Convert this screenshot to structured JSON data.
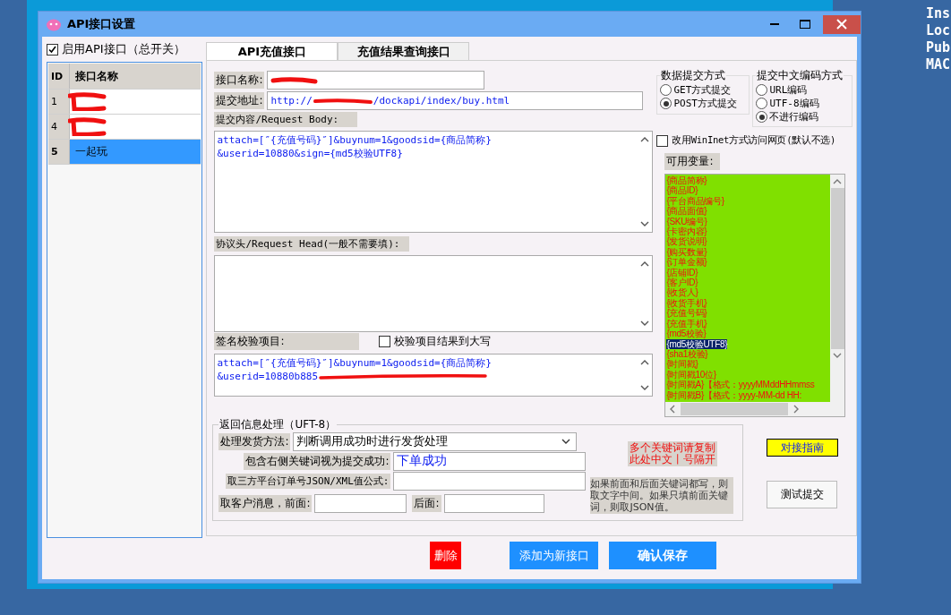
{
  "window": {
    "title": "API接口设置"
  },
  "desktop_text": [
    "Ins",
    "Loc",
    "Pub",
    "MAC"
  ],
  "master_switch": {
    "label": "启用API接口（总开关）",
    "checked": true
  },
  "interface_list": {
    "columns": [
      "ID",
      "接口名称"
    ],
    "rows": [
      {
        "id": "1",
        "redacted": true,
        "selected": false
      },
      {
        "id": "4",
        "redacted": true,
        "selected": false
      },
      {
        "id": "5",
        "name": "一起玩",
        "redacted": false,
        "selected": true
      }
    ]
  },
  "tabs": [
    {
      "label": "API充值接口",
      "selected": true
    },
    {
      "label": "充值结果查询接口",
      "selected": false
    }
  ],
  "form": {
    "name": {
      "label": "接口名称:",
      "redacted": true
    },
    "url": {
      "label": "提交地址:",
      "prefix": "http://",
      "suffix": "/dockapi/index/buy.html",
      "redacted": true
    },
    "body": {
      "label": "提交内容/Request Body:",
      "lines": [
        "attach=[″{充值号码}″]&buynum=1&goodsid={商品简称}",
        "&userid=10880&sign={md5校验UTF8}"
      ]
    },
    "head": {
      "label": "协议头/Request Head(一般不需要填):"
    },
    "sign": {
      "label": "签名校验项目:",
      "uppercase_label": "校验项目结果到大写",
      "uppercase": false,
      "lines": [
        "attach=[″{充值号码}″]&buynum=1&goodsid={商品简称}",
        "&userid=10880b885"
      ],
      "redacted": true
    }
  },
  "submit_method": {
    "title": "数据提交方式",
    "options": [
      {
        "label": "GET方式提交",
        "selected": false
      },
      {
        "label": "POST方式提交",
        "selected": true
      }
    ]
  },
  "encoding": {
    "title": "提交中文编码方式",
    "options": [
      {
        "label": "URL编码",
        "selected": false
      },
      {
        "label": "UTF-8编码",
        "selected": false
      },
      {
        "label": "不进行编码",
        "selected": true
      }
    ]
  },
  "wininet": {
    "label": "改用WinInet方式访问网页(默认不选)",
    "checked": false
  },
  "variables": {
    "label": "可用变量:",
    "items": [
      {
        "text": "{商品简称}",
        "selected": false
      },
      {
        "text": "{商品ID}",
        "selected": false
      },
      {
        "text": "{平台商品编号}",
        "selected": false
      },
      {
        "text": "{商品面值}",
        "selected": false
      },
      {
        "text": "{SKU编号}",
        "selected": false
      },
      {
        "text": "{卡密内容}",
        "selected": false
      },
      {
        "text": "{发货说明}",
        "selected": false
      },
      {
        "text": "{购买数量}",
        "selected": false
      },
      {
        "text": "{订单金额}",
        "selected": false
      },
      {
        "text": "{店铺ID}",
        "selected": false
      },
      {
        "text": "{客户ID}",
        "selected": false
      },
      {
        "text": "{收货人}",
        "selected": false
      },
      {
        "text": "{收货手机}",
        "selected": false
      },
      {
        "text": "{充值号码}",
        "selected": false
      },
      {
        "text": "{充值手机}",
        "selected": false
      },
      {
        "text": "{md5校验}",
        "selected": false
      },
      {
        "text": "{md5校验UTF8}",
        "selected": true
      },
      {
        "text": "{sha1校验}",
        "selected": false
      },
      {
        "text": "{时间戳}",
        "selected": false
      },
      {
        "text": "{时间戳10位}",
        "selected": false
      },
      {
        "text": "{时间戳A}【格式：yyyyMMddHHmmss",
        "selected": false
      },
      {
        "text": "{时间戳B}【格式：yyyy-MM-dd HH:",
        "selected": false
      }
    ]
  },
  "response": {
    "title": "返回信息处理（UFT-8）",
    "method": {
      "label": "处理发货方法:",
      "value": "判断调用成功时进行发货处理"
    },
    "success_keyword": {
      "label": "包含右侧关键词视为提交成功:",
      "value": "下单成功"
    },
    "order_formula": {
      "label": "取三方平台订单号JSON/XML值公式:"
    },
    "message_before": {
      "label": "取客户消息，前面:"
    },
    "message_after": {
      "label": "后面:"
    },
    "keyword_note": [
      "多个关键词请复制",
      "此处中文丨号隔开"
    ],
    "hint": "如果前面和后面关键词都写，则取文字中间。如果只填前面关键词，则取JSON值。"
  },
  "side_buttons": [
    {
      "label": "对接指南",
      "kind": "guide"
    },
    {
      "label": "测试提交",
      "kind": "plain"
    }
  ],
  "buttons": [
    {
      "label": "删除",
      "kind": "danger"
    },
    {
      "label": "添加为新接口",
      "kind": "primary"
    },
    {
      "label": "确认保存",
      "kind": "strong"
    }
  ]
}
